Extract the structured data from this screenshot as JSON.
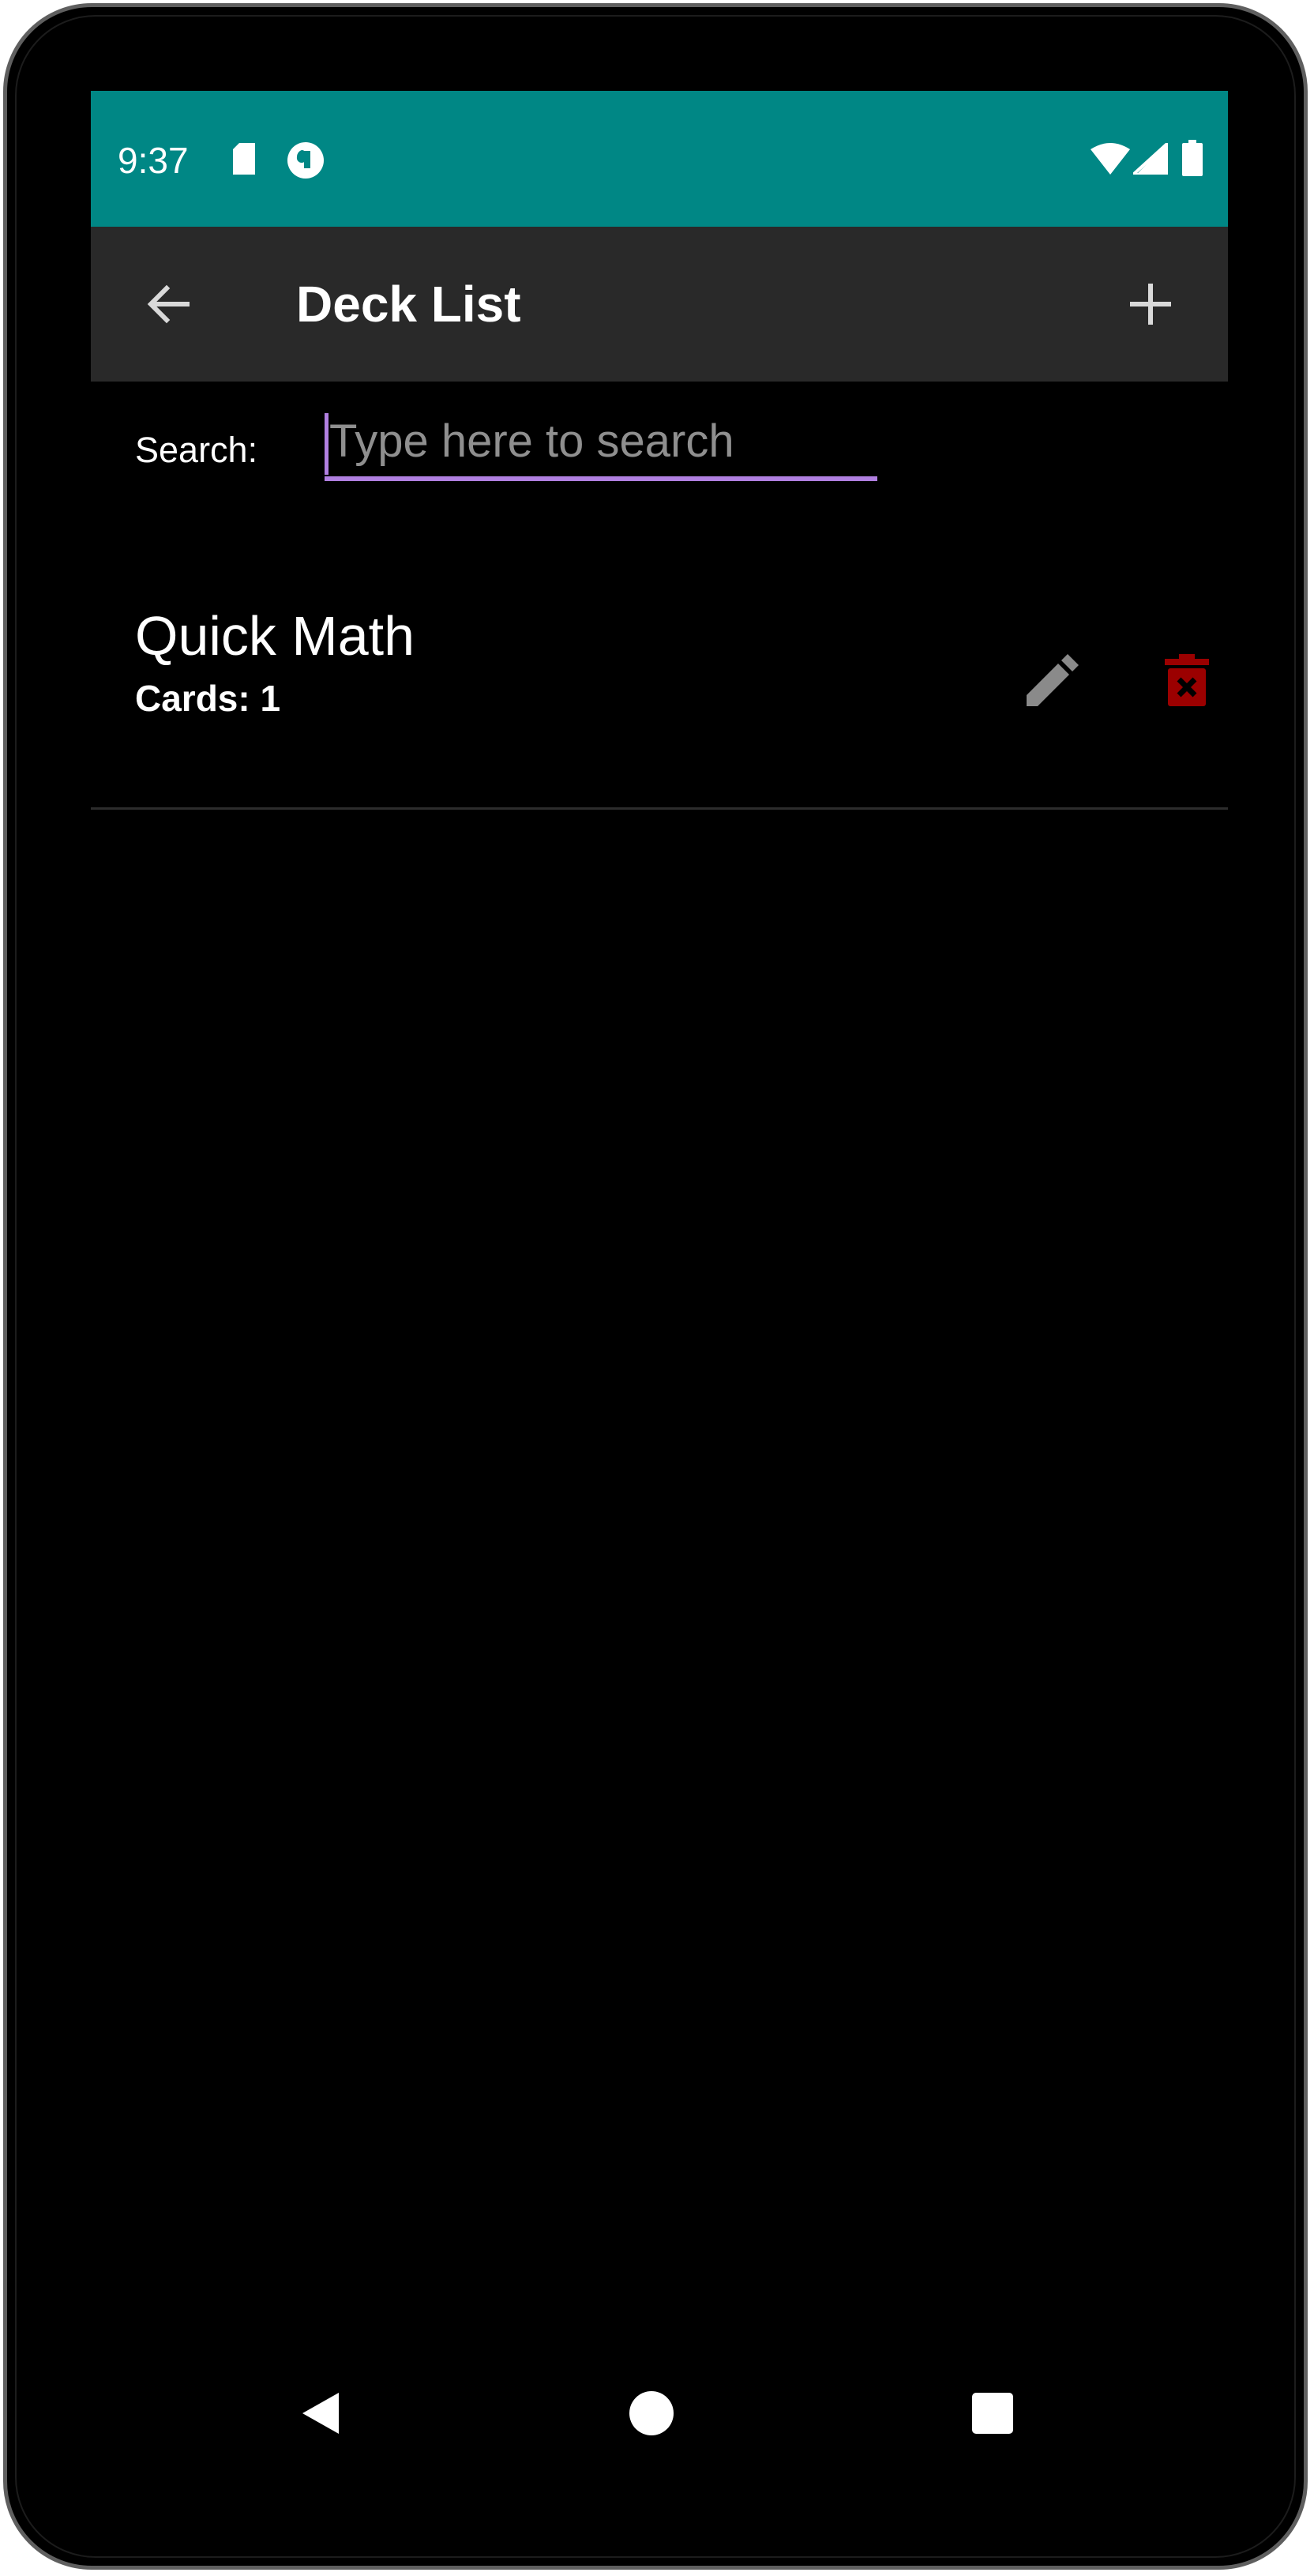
{
  "status_bar": {
    "time": "9:37",
    "background_color": "#008785",
    "icons": [
      "sd-card-icon",
      "app-notification-icon",
      "wifi-icon",
      "cell-signal-icon",
      "battery-icon"
    ]
  },
  "app_bar": {
    "title": "Deck List",
    "back_icon": "arrow-back-icon",
    "add_icon": "plus-icon",
    "background_color": "#292929"
  },
  "search": {
    "label": "Search:",
    "value": "",
    "placeholder": "Type here to search",
    "accent_color": "#b07fe0"
  },
  "decks": [
    {
      "name": "Quick Math",
      "count_text": "Cards: 1",
      "edit_icon": "pencil-icon",
      "delete_icon": "trash-icon",
      "delete_color": "#9b0000"
    }
  ],
  "nav_bar": {
    "icons": [
      "nav-back-icon",
      "nav-home-icon",
      "nav-recents-icon"
    ]
  }
}
